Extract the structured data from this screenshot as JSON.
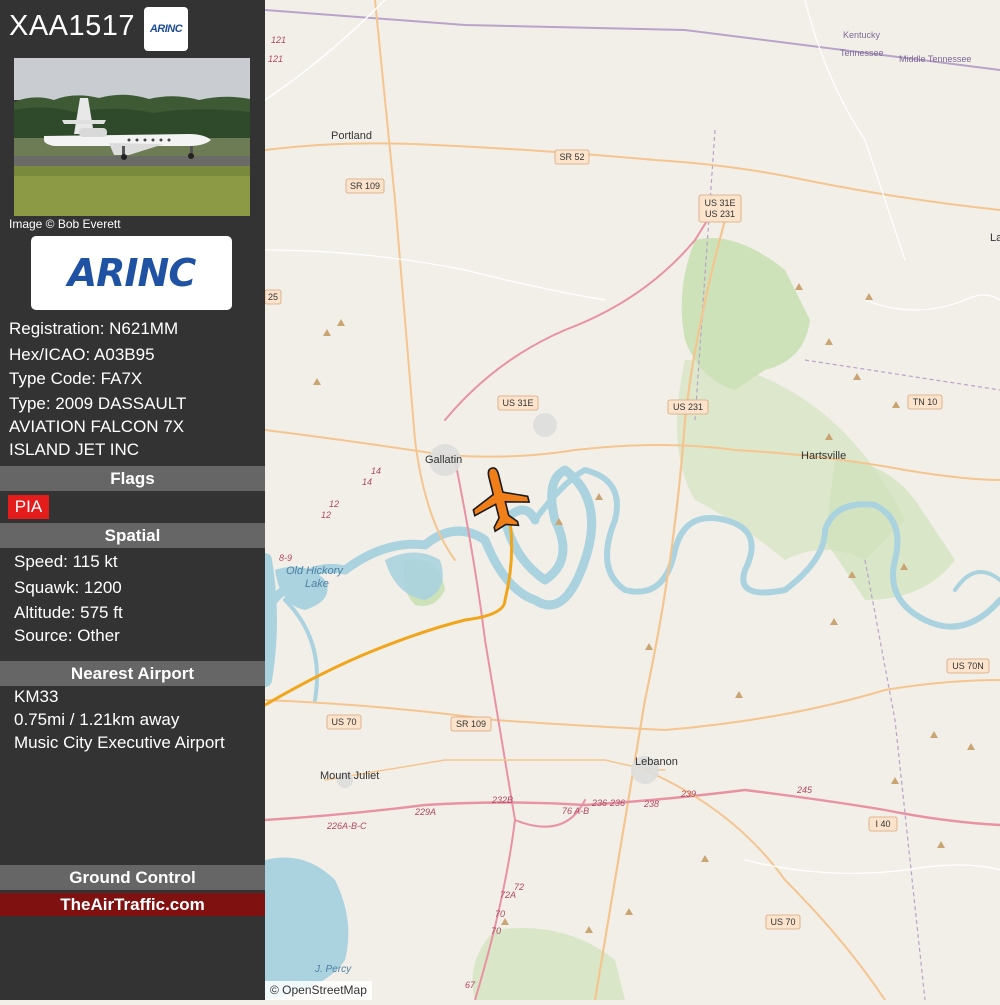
{
  "header": {
    "callsign": "XAA1517",
    "operator_logo_text": "ARINC"
  },
  "photo": {
    "credit": "Image © Bob Everett"
  },
  "operator_logo": {
    "text": "ARINC",
    "color": "#1f52a3"
  },
  "aircraft": {
    "registration": "Registration: N621MM",
    "hex": "Hex/ICAO: A03B95",
    "type_code": "Type Code: FA7X",
    "type_line1": "Type: 2009 DASSAULT",
    "type_line2": "AVIATION FALCON 7X",
    "owner": "ISLAND JET INC"
  },
  "flags": {
    "heading": "Flags",
    "items": [
      "PIA"
    ],
    "color": "#e41c1c"
  },
  "spatial": {
    "heading": "Spatial",
    "speed": "Speed: 115 kt",
    "squawk": "Squawk: 1200",
    "altitude": "Altitude: 575 ft",
    "source": "Source: Other"
  },
  "nearest_airport": {
    "heading": "Nearest Airport",
    "code": "KM33",
    "distance": "0.75mi / 1.21km away",
    "name": "Music City Executive Airport"
  },
  "ground_control": {
    "heading": "Ground Control",
    "site": "TheAirTraffic.com",
    "bar_color": "#7f1111"
  },
  "map": {
    "attribution": "© OpenStreetMap",
    "places": [
      "Portland",
      "Gallatin",
      "Hartsville",
      "Old Hickory",
      "Lake",
      "Mount Juliet",
      "Lebanon",
      "Kentucky",
      "Tennessee",
      "Middle Tennessee",
      "J. Percy",
      "La"
    ],
    "road_shields": [
      "SR 52",
      "SR 109",
      "US 31E",
      "US 231",
      "US 31E",
      "US 231",
      "TN 10",
      "US 70N",
      "US 70",
      "SR 109",
      "I 40",
      "US 70",
      "25"
    ],
    "road_numbers": [
      "121",
      "121",
      "14",
      "14",
      "12",
      "12",
      "8-9",
      "229A",
      "226A-B-C",
      "232B",
      "76 A-B",
      "236",
      "236",
      "238",
      "239",
      "245",
      "72A",
      "72",
      "70",
      "70",
      "67"
    ],
    "aircraft_icon": "airplane-icon",
    "aircraft_color": "#f07f1a",
    "track_color": "#f0a51a",
    "water_color": "#aad3df",
    "forest_color": "#c8e0b0"
  }
}
